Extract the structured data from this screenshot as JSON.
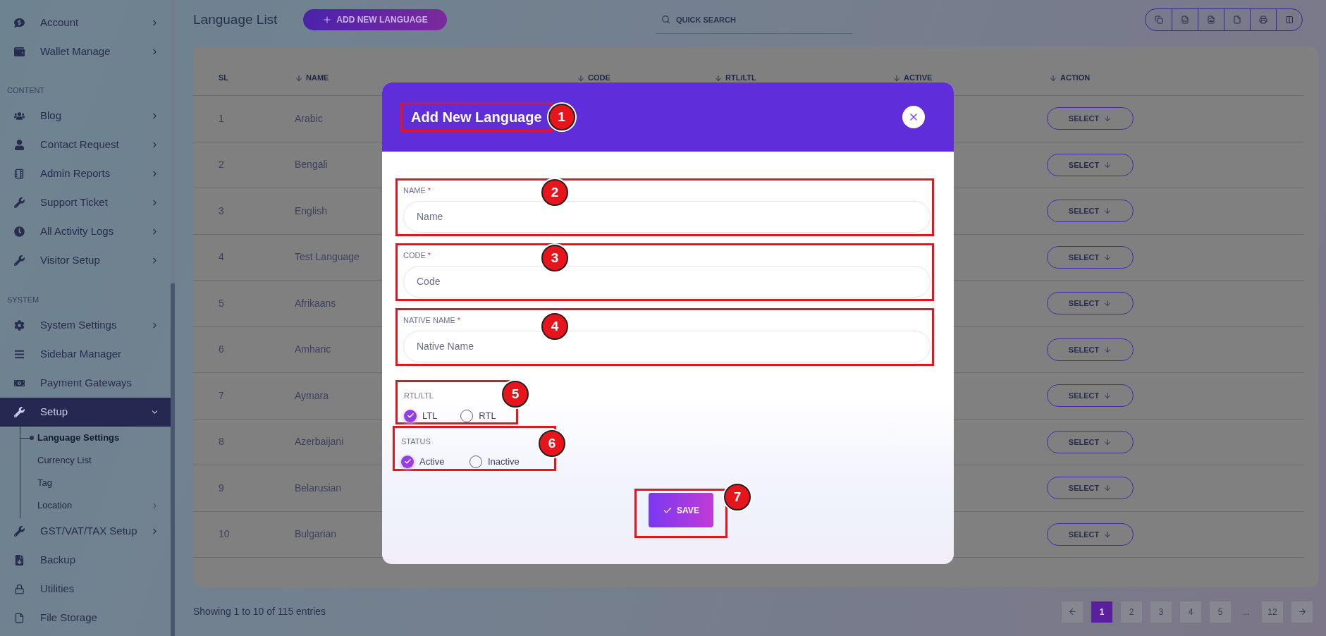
{
  "sidebar": {
    "sections": [
      {
        "items": [
          {
            "label": "Account",
            "submenu": true,
            "selected": false
          },
          {
            "label": "Wallet Manage",
            "submenu": true,
            "selected": false
          }
        ]
      },
      {
        "title": "CONTENT",
        "items": [
          {
            "label": "Blog",
            "submenu": true,
            "selected": false
          },
          {
            "label": "Contact Request",
            "submenu": true,
            "selected": false
          },
          {
            "label": "Admin Reports",
            "submenu": true,
            "selected": false
          },
          {
            "label": "Support Ticket",
            "submenu": true,
            "selected": false
          },
          {
            "label": "All Activity Logs",
            "submenu": true,
            "selected": false
          },
          {
            "label": "Visitor Setup",
            "submenu": true,
            "selected": false
          }
        ]
      },
      {
        "title": "SYSTEM",
        "items": [
          {
            "label": "System Settings",
            "submenu": true,
            "selected": false
          },
          {
            "label": "Sidebar Manager",
            "submenu": false,
            "selected": false
          },
          {
            "label": "Payment Gateways",
            "submenu": false,
            "selected": false
          },
          {
            "label": "Setup",
            "submenu": true,
            "selected": true,
            "children": [
              {
                "label": "Language Settings",
                "submenu": false,
                "selected": true
              },
              {
                "label": "Currency List",
                "submenu": false,
                "selected": false
              },
              {
                "label": "Tag",
                "submenu": false,
                "selected": false
              },
              {
                "label": "Location",
                "submenu": true,
                "selected": false
              }
            ]
          },
          {
            "label": "GST/VAT/TAX Setup",
            "submenu": true,
            "selected": false
          },
          {
            "label": "Backup",
            "submenu": false,
            "selected": false
          },
          {
            "label": "Utilities",
            "submenu": false,
            "selected": false
          },
          {
            "label": "File Storage",
            "submenu": false,
            "selected": false
          }
        ]
      }
    ]
  },
  "header": {
    "title": "Language List",
    "add_button": "ADD NEW LANGUAGE",
    "search": {
      "placeholder": "QUICK SEARCH"
    }
  },
  "table": {
    "columns": [
      {
        "label": "SL",
        "sortable": false
      },
      {
        "label": "NAME",
        "sortable": true
      },
      {
        "label": "CODE",
        "sortable": true
      },
      {
        "label": "RTL/LTL",
        "sortable": true
      },
      {
        "label": "ACTIVE",
        "sortable": true
      },
      {
        "label": "ACTION",
        "sortable": true
      }
    ],
    "rows": [
      {
        "sl": "1",
        "name": "Arabic",
        "action": "SELECT"
      },
      {
        "sl": "2",
        "name": "Bengali",
        "action": "SELECT"
      },
      {
        "sl": "3",
        "name": "English",
        "action": "SELECT"
      },
      {
        "sl": "4",
        "name": "Test Language",
        "action": "SELECT"
      },
      {
        "sl": "5",
        "name": "Afrikaans",
        "action": "SELECT"
      },
      {
        "sl": "6",
        "name": "Amharic",
        "action": "SELECT"
      },
      {
        "sl": "7",
        "name": "Aymara",
        "action": "SELECT"
      },
      {
        "sl": "8",
        "name": "Azerbaijani",
        "action": "SELECT"
      },
      {
        "sl": "9",
        "name": "Belarusian",
        "action": "SELECT"
      },
      {
        "sl": "10",
        "name": "Bulgarian",
        "action": "SELECT"
      }
    ]
  },
  "footer": {
    "summary": "Showing 1 to 10 of 115 entries",
    "pages": [
      {
        "kind": "page",
        "label": "1",
        "selected": true
      },
      {
        "kind": "page",
        "label": "2",
        "selected": false
      },
      {
        "kind": "page",
        "label": "3",
        "selected": false
      },
      {
        "kind": "page",
        "label": "4",
        "selected": false
      },
      {
        "kind": "page",
        "label": "5",
        "selected": false
      },
      {
        "kind": "gap",
        "label": "..."
      },
      {
        "kind": "page",
        "label": "12",
        "selected": false
      }
    ]
  },
  "modal": {
    "title": "Add New Language",
    "marker": "1",
    "fields": [
      {
        "label": "NAME",
        "required_mark": "*",
        "placeholder": "Name",
        "marker": "2"
      },
      {
        "label": "CODE",
        "required_mark": "*",
        "placeholder": "Code",
        "marker": "3"
      },
      {
        "label": "NATIVE NAME",
        "required_mark": "*",
        "placeholder": "Native Name",
        "marker": "4"
      }
    ],
    "radio_groups": [
      {
        "label": "RTL/LTL",
        "marker": "5",
        "options": [
          {
            "label": "LTL",
            "selected": true
          },
          {
            "label": "RTL",
            "selected": false
          }
        ]
      },
      {
        "label": "STATUS",
        "marker": "6",
        "options": [
          {
            "label": "Active",
            "selected": true
          },
          {
            "label": "Inactive",
            "selected": false
          }
        ]
      }
    ],
    "save_button": "SAVE",
    "save_marker": "7"
  }
}
